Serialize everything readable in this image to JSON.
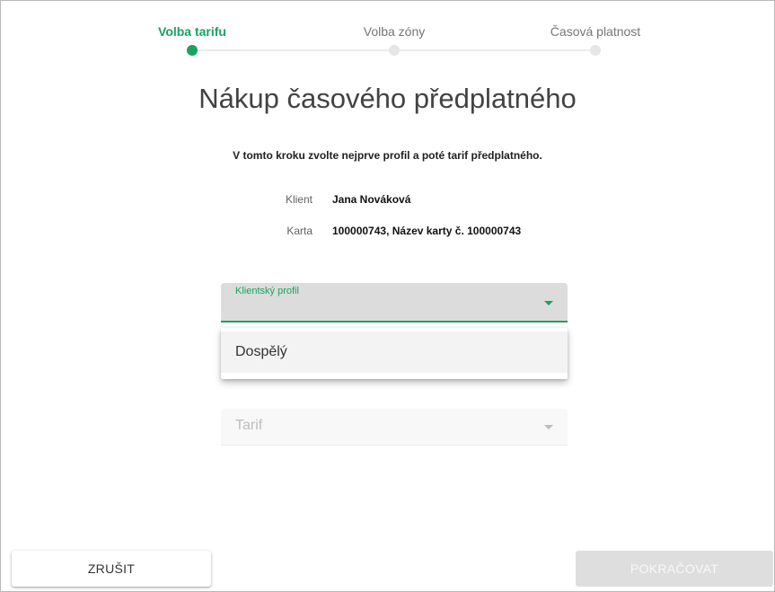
{
  "stepper": {
    "steps": [
      {
        "label": "Volba tarifu",
        "active": true
      },
      {
        "label": "Volba zóny",
        "active": false
      },
      {
        "label": "Časová platnost",
        "active": false
      }
    ]
  },
  "page": {
    "title": "Nákup časového předplatného",
    "instruction": "V tomto kroku zvolte nejprve profil a poté tarif předplatného."
  },
  "info": {
    "client_label": "Klient",
    "client_value": "Jana Nováková",
    "card_label": "Karta",
    "card_value": "100000743, Název karty č. 100000743"
  },
  "profile_select": {
    "label": "Klientský profil",
    "options": [
      "Dospělý"
    ]
  },
  "tarif_select": {
    "placeholder": "Tarif"
  },
  "buttons": {
    "cancel": "ZRUŠIT",
    "continue": "POKRAČOVAT"
  },
  "colors": {
    "accent": "#1aa260",
    "inactive": "#e6e6e6"
  }
}
